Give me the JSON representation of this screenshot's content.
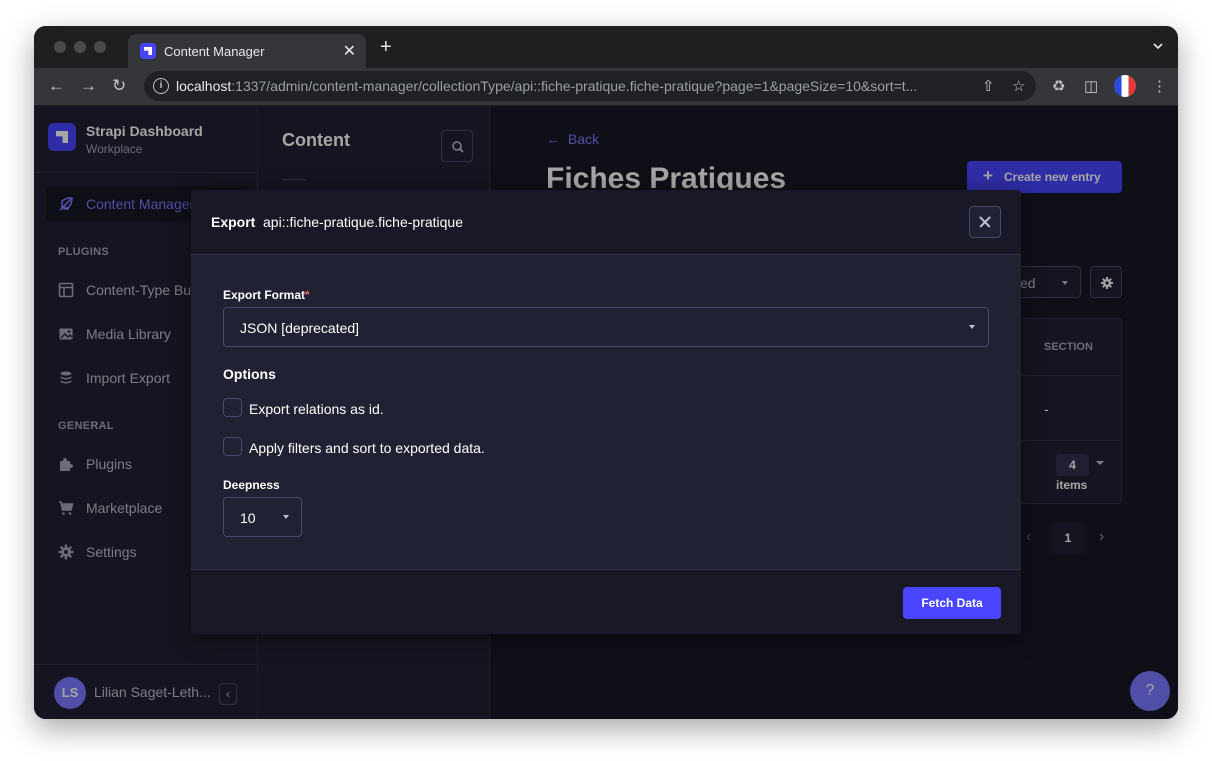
{
  "browser": {
    "tab_title": "Content Manager",
    "tab_close": "✕",
    "new_tab": "+",
    "url_host": "localhost",
    "url_rest": ":1337/admin/content-manager/collectionType/api::fiche-pratique.fiche-pratique?page=1&pageSize=10&sort=t..."
  },
  "mainnav": {
    "brand_name": "Strapi Dashboard",
    "brand_sub": "Workplace",
    "items": [
      {
        "label": "Content Manager",
        "icon": "feather-icon",
        "active": true
      },
      {
        "label": "Content-Type Builder",
        "icon": "layout-icon"
      },
      {
        "label": "Media Library",
        "icon": "image-icon"
      },
      {
        "label": "Import Export",
        "icon": "database-icon"
      },
      {
        "label": "Plugins",
        "icon": "puzzle-icon"
      },
      {
        "label": "Marketplace",
        "icon": "cart-icon"
      },
      {
        "label": "Settings",
        "icon": "gear-icon"
      }
    ],
    "sections": {
      "plugins": "PLUGINS",
      "general": "GENERAL"
    },
    "user": {
      "initials": "LS",
      "name": "Lilian Saget-Leth..."
    },
    "collapse": "‹"
  },
  "subnav": {
    "title": "Content"
  },
  "content": {
    "back": "Back",
    "back_arrow": "←",
    "title": "Fiches Pratiques",
    "create_plus": "+",
    "create_label": "Create new entry",
    "filter_value": "ed",
    "table": {
      "header": "SECTION",
      "row1": "-",
      "row2_count": "4",
      "row2_label": "items"
    },
    "pagination": {
      "prev": "‹",
      "current": "1",
      "next": "›"
    },
    "help": "?"
  },
  "modal": {
    "title": "Export",
    "title_value": "api::fiche-pratique.fiche-pratique",
    "format_label": "Export Format",
    "required_mark": "*",
    "format_value": "JSON [deprecated]",
    "options_title": "Options",
    "option1": "Export relations as id.",
    "option2": "Apply filters and sort to exported data.",
    "deepness_label": "Deepness",
    "deepness_value": "10",
    "fetch_label": "Fetch Data"
  }
}
